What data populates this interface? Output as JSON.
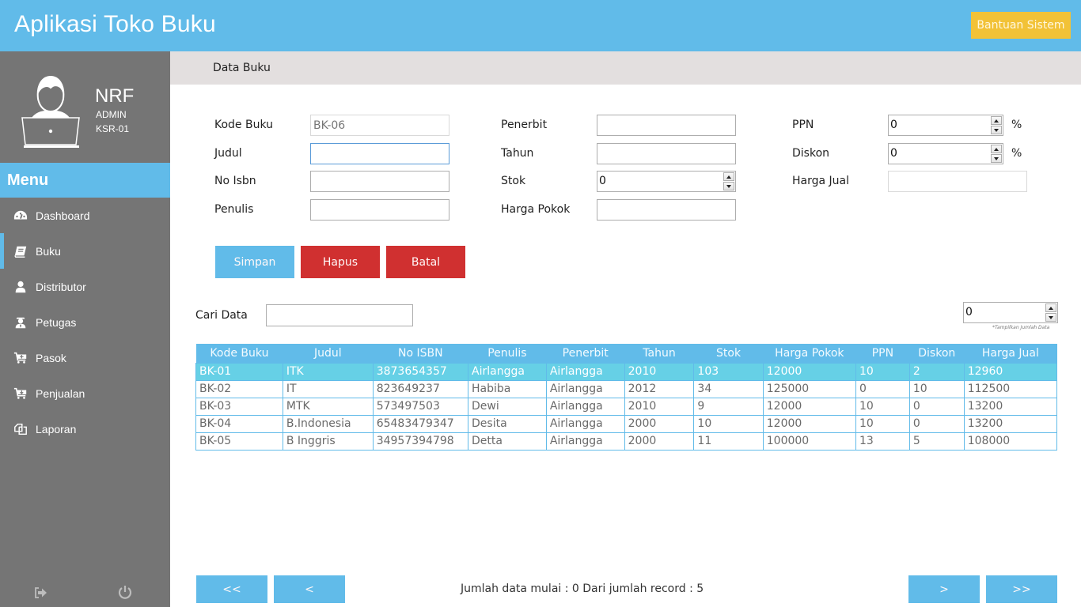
{
  "header": {
    "title": "Aplikasi Toko Buku",
    "help_button": "Bantuan Sistem"
  },
  "colors": {
    "primary": "#61bbe9",
    "help": "#f2c237",
    "danger": "#d03030",
    "sidebar": "#757575",
    "row_selected": "#66d0e6"
  },
  "profile": {
    "name": "NRF",
    "role": "ADMIN",
    "code": "KSR-01",
    "avatar_icon": "user-laptop-icon"
  },
  "sidebar": {
    "menu_title": "Menu",
    "items": [
      {
        "label": "Dashboard",
        "icon": "dashboard-icon",
        "active": false
      },
      {
        "label": "Buku",
        "icon": "book-icon",
        "active": true
      },
      {
        "label": "Distributor",
        "icon": "user-icon",
        "active": false
      },
      {
        "label": "Petugas",
        "icon": "staff-icon",
        "active": false
      },
      {
        "label": "Pasok",
        "icon": "cart-plus-icon",
        "active": false
      },
      {
        "label": "Penjualan",
        "icon": "cart-down-icon",
        "active": false
      },
      {
        "label": "Laporan",
        "icon": "report-icon",
        "active": false
      }
    ],
    "footer": {
      "logout_icon": "sign-out-icon",
      "power_icon": "power-icon"
    }
  },
  "breadcrumb": "Data Buku",
  "form": {
    "kode_buku": {
      "label": "Kode Buku",
      "value": "BK-06"
    },
    "judul": {
      "label": "Judul",
      "value": ""
    },
    "no_isbn": {
      "label": "No Isbn",
      "value": ""
    },
    "penulis": {
      "label": "Penulis",
      "value": ""
    },
    "penerbit": {
      "label": "Penerbit",
      "value": ""
    },
    "tahun": {
      "label": "Tahun",
      "value": ""
    },
    "stok": {
      "label": "Stok",
      "value": "0"
    },
    "harga_pokok": {
      "label": "Harga Pokok",
      "value": ""
    },
    "ppn": {
      "label": "PPN",
      "value": "0",
      "unit": "%"
    },
    "diskon": {
      "label": "Diskon",
      "value": "0",
      "unit": "%"
    },
    "harga_jual": {
      "label": "Harga Jual",
      "value": ""
    }
  },
  "actions": {
    "save": "Simpan",
    "delete": "Hapus",
    "cancel": "Batal"
  },
  "search": {
    "label": "Cari Data",
    "value": ""
  },
  "display_count": {
    "value": "0",
    "hint": "*Tampilkan Jumlah Data"
  },
  "table": {
    "columns": [
      "Kode Buku",
      "Judul",
      "No ISBN",
      "Penulis",
      "Penerbit",
      "Tahun",
      "Stok",
      "Harga Pokok",
      "PPN",
      "Diskon",
      "Harga Jual"
    ],
    "rows": [
      [
        "BK-01",
        "ITK",
        "3873654357",
        "Airlangga",
        "Airlangga",
        "2010",
        "103",
        "12000",
        "10",
        "2",
        "12960"
      ],
      [
        "BK-02",
        "IT",
        "823649237",
        "Habiba",
        "Airlangga",
        "2012",
        "34",
        "125000",
        "0",
        "10",
        "112500"
      ],
      [
        "BK-03",
        "MTK",
        "573497503",
        "Dewi",
        "Airlangga",
        "2010",
        "9",
        "12000",
        "10",
        "0",
        "13200"
      ],
      [
        "BK-04",
        "B.Indonesia",
        "65483479347",
        "Desita",
        "Airlangga",
        "2000",
        "10",
        "12000",
        "10",
        "0",
        "13200"
      ],
      [
        "BK-05",
        "B Inggris",
        "34957394798",
        "Detta",
        "Airlangga",
        "2000",
        "11",
        "100000",
        "13",
        "5",
        "108000"
      ]
    ],
    "selected_row": 0
  },
  "pager": {
    "first": "<<",
    "prev": "<",
    "next": ">",
    "last": ">>",
    "status": "Jumlah data mulai : 0 Dari jumlah record : 5"
  }
}
